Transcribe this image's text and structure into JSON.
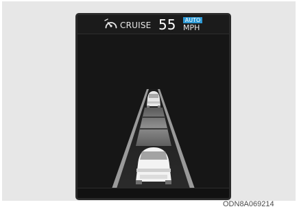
{
  "cluster": {
    "cruise_label": "CRUISE",
    "set_speed": "55",
    "mode_badge": "AUTO",
    "speed_unit": "MPH",
    "icon": "cruise-speedometer-icon",
    "colors": {
      "badge": "#2f9bd6",
      "screen_bg": "#161616",
      "text": "#e9e9e9"
    }
  },
  "figure_code": "ODN8A069214"
}
